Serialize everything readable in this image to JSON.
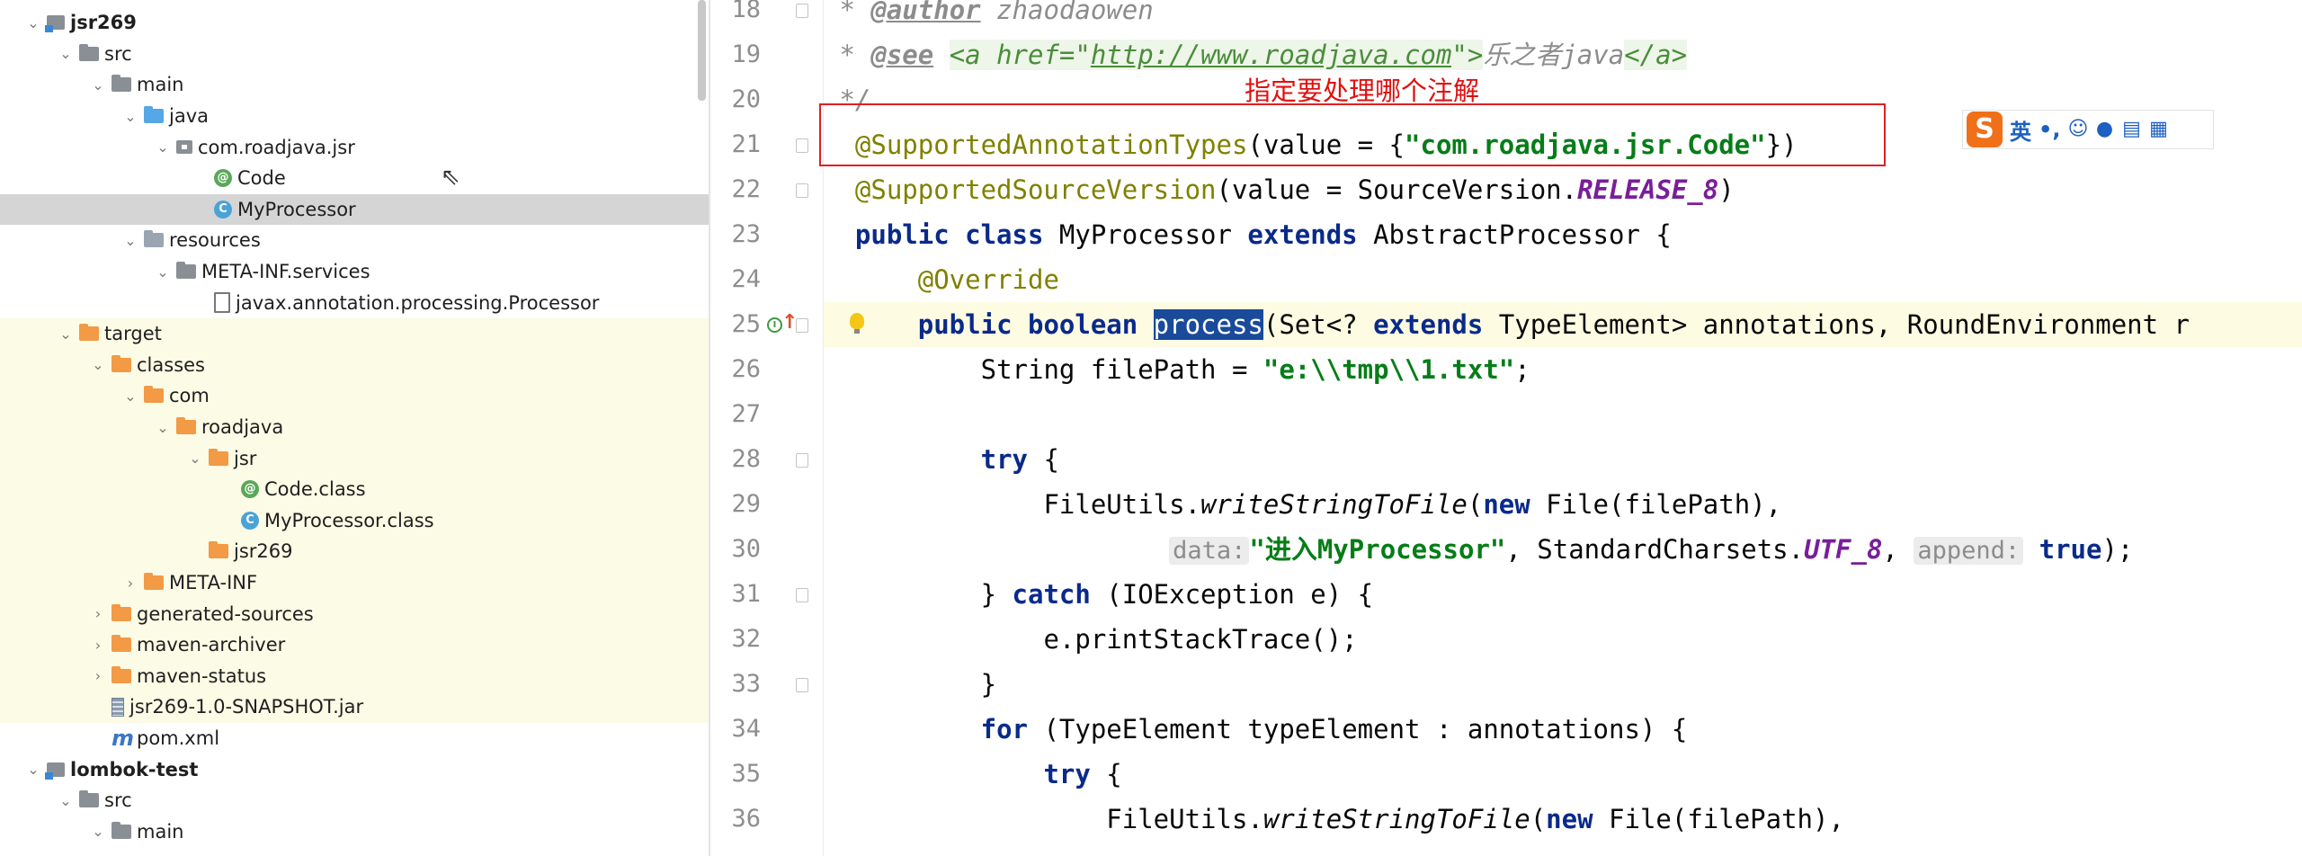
{
  "project_tree": [
    {
      "label": "jsr269",
      "icon": "module-icon",
      "arrow": "▾",
      "bold": true
    },
    {
      "label": "src",
      "icon": "folder-icon",
      "arrow": "▾"
    },
    {
      "label": "main",
      "icon": "folder-icon",
      "arrow": "▾"
    },
    {
      "label": "java",
      "icon": "source-folder-icon",
      "arrow": "▾"
    },
    {
      "label": "com.roadjava.jsr",
      "icon": "package-icon",
      "arrow": "▾"
    },
    {
      "label": "Code",
      "icon": "annotation-icon",
      "arrow": ""
    },
    {
      "label": "MyProcessor",
      "icon": "class-icon",
      "arrow": "",
      "selected": true
    },
    {
      "label": "resources",
      "icon": "resources-folder-icon",
      "arrow": "▾"
    },
    {
      "label": "META-INF.services",
      "icon": "folder-icon",
      "arrow": "▾"
    },
    {
      "label": "javax.annotation.processing.Processor",
      "icon": "file-icon",
      "arrow": ""
    },
    {
      "label": "target",
      "icon": "excluded-folder-icon",
      "arrow": "▾",
      "highlight": true
    },
    {
      "label": "classes",
      "icon": "excluded-folder-icon",
      "arrow": "▾",
      "highlight": true
    },
    {
      "label": "com",
      "icon": "excluded-folder-icon",
      "arrow": "▾",
      "highlight": true
    },
    {
      "label": "roadjava",
      "icon": "excluded-folder-icon",
      "arrow": "▾",
      "highlight": true
    },
    {
      "label": "jsr",
      "icon": "excluded-folder-icon",
      "arrow": "▾",
      "highlight": true
    },
    {
      "label": "Code.class",
      "icon": "annotation-icon",
      "arrow": "",
      "highlight": true
    },
    {
      "label": "MyProcessor.class",
      "icon": "class-icon",
      "arrow": "",
      "highlight": true
    },
    {
      "label": "jsr269",
      "icon": "excluded-folder-icon",
      "arrow": "",
      "highlight": true
    },
    {
      "label": "META-INF",
      "icon": "excluded-folder-icon",
      "arrow": "▸",
      "highlight": true
    },
    {
      "label": "generated-sources",
      "icon": "excluded-folder-icon",
      "arrow": "▸",
      "highlight": true
    },
    {
      "label": "maven-archiver",
      "icon": "excluded-folder-icon",
      "arrow": "▸",
      "highlight": true
    },
    {
      "label": "maven-status",
      "icon": "excluded-folder-icon",
      "arrow": "▸",
      "highlight": true
    },
    {
      "label": "jsr269-1.0-SNAPSHOT.jar",
      "icon": "jar-icon",
      "arrow": "",
      "highlight": true
    },
    {
      "label": "pom.xml",
      "icon": "maven-icon",
      "arrow": ""
    },
    {
      "label": "lombok-test",
      "icon": "module-icon",
      "arrow": "▾",
      "bold": true
    },
    {
      "label": "src",
      "icon": "folder-icon",
      "arrow": "▾"
    },
    {
      "label": "main",
      "icon": "folder-icon",
      "arrow": "▾"
    }
  ],
  "line_numbers": [
    "18",
    "19",
    "20",
    "21",
    "22",
    "23",
    "24",
    "25",
    "26",
    "27",
    "28",
    "29",
    "30",
    "31",
    "32",
    "33",
    "34",
    "35",
    "36"
  ],
  "code": {
    "l18_star": " * ",
    "l18_tag": "@author",
    "l18_text": " zhaodaowen",
    "l19_star": " * ",
    "l19_tag": "@see",
    "l19_a_open": "<a href=\"",
    "l19_url": "http://www.roadjava.com",
    "l19_a_close": "\">",
    "l19_cn": "乐之者java",
    "l19_a_end": "</a>",
    "l20": " */",
    "l21_ann": "@SupportedAnnotationTypes",
    "l21_mid": "(value = {",
    "l21_str": "\"com.roadjava.jsr.Code\"",
    "l21_end": "})",
    "l22_ann": "@SupportedSourceVersion",
    "l22_mid": "(value = SourceVersion.",
    "l22_stat": "RELEASE_8",
    "l22_end": ")",
    "l23_kw1": "public class",
    "l23_t1": " MyProcessor ",
    "l23_kw2": "extends",
    "l23_t2": " AbstractProcessor {",
    "l24_ann": "@Override",
    "l25_kw1": "public boolean",
    "l25_sel": "process",
    "l25_t1": "(Set<? ",
    "l25_kw2": "extends",
    "l25_t2": " TypeElement> annotations, RoundEnvironment r",
    "l26_t1": "String filePath = ",
    "l26_str": "\"e:\\\\tmp\\\\1.txt\"",
    "l26_end": ";",
    "l28_kw": "try",
    "l28_t": " {",
    "l29_t1": "FileUtils.",
    "l29_m": "writeStringToFile",
    "l29_t2": "(",
    "l29_kw": "new",
    "l29_t3": " File(filePath),",
    "l30_hint1": "data:",
    "l30_str": "\"进入MyProcessor\"",
    "l30_t1": ", StandardCharsets.",
    "l30_stat": "UTF_8",
    "l30_t2": ", ",
    "l30_hint2": "append:",
    "l30_kw": "true",
    "l30_end": ");",
    "l31_t1": "} ",
    "l31_kw": "catch",
    "l31_t2": " (IOException e) {",
    "l32": "e.printStackTrace();",
    "l33": "}",
    "l34_kw": "for",
    "l34_t": " (TypeElement typeElement : annotations) {",
    "l35_kw": "try",
    "l35_t": " {",
    "l36_t1": "FileUtils.",
    "l36_m": "writeStringToFile",
    "l36_t2": "(",
    "l36_kw": "new",
    "l36_t3": " File(filePath),"
  },
  "annotation_note": "指定要处理哪个注解",
  "ime": {
    "logo": "S",
    "mode": "英",
    "punct": "•,"
  },
  "colors": {
    "keyword": "#0a2a8a",
    "annotation": "#808000",
    "string": "#067d17",
    "static": "#7a1d9a",
    "highlight": "#e02020",
    "selection": "#1a4a9a"
  }
}
